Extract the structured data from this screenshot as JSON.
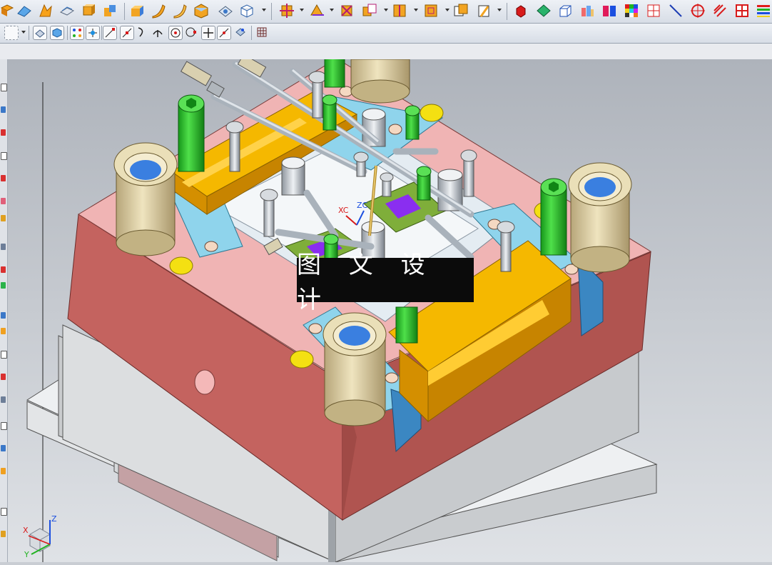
{
  "viewport": {
    "watermark_text": "图 文 设 计",
    "wcs_x_label": "XC",
    "wcs_z_label": "ZC",
    "triad_z_label": "Z",
    "triad_y_label": "Y",
    "triad_x_label": "X"
  },
  "colors": {
    "pink_plate": "#f0b4b4",
    "pink_side": "#c4635f",
    "gray_plate": "#d4d6d8",
    "orange_slider": "#f5b800",
    "green_bolt": "#22c01f",
    "cyan_block": "#8fd4ec",
    "bronze_bushing": "#dccfa3",
    "blue_spring": "#2a2ad4",
    "violet_insert": "#8d30e8"
  }
}
